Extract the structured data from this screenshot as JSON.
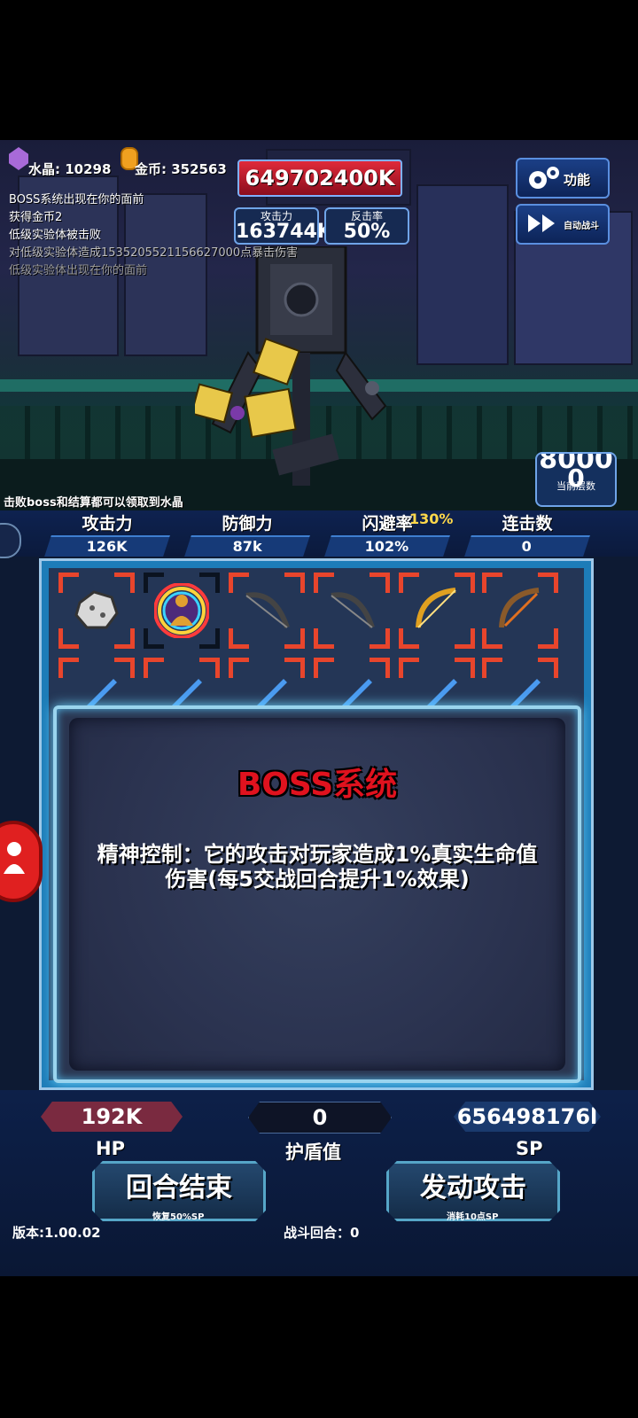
{
  "resources": {
    "crystal_label": "水晶:",
    "crystal_value": "10298",
    "gold_label": "金币:",
    "gold_value": "352563"
  },
  "boss": {
    "hp": "649702400K",
    "attack_label": "攻击力",
    "attack_value": "163744K",
    "counter_label": "反击率",
    "counter_value": "50%"
  },
  "log": [
    "BOSS系统出现在你的面前",
    "获得金币2",
    "低级实验体被击败",
    "对低级实验体造成1535205521156627000点暴击伤害",
    "低级实验体出现在你的面前"
  ],
  "menu": {
    "function_label": "功能",
    "auto_battle_label": "自动战斗"
  },
  "floor": {
    "top_value": "8000",
    "current_value": "0",
    "label": "当前层数"
  },
  "hint": "击败boss和结算都可以领取到水晶",
  "player_stats": {
    "attack_label": "攻击力",
    "attack_value": "126K",
    "defense_label": "防御力",
    "defense_value": "87k",
    "dodge_label": "闪避率",
    "dodge_value": "102%",
    "dodge_bonus": "130%",
    "combo_label": "连击数",
    "combo_value": "0"
  },
  "inventory_icons": [
    "rock-icon",
    "buddha-icon",
    "dark-bow-icon",
    "dark-bow-icon",
    "golden-bow-icon",
    "wooden-bow-icon",
    "blue-sword-icon",
    "blue-sword-icon",
    "blue-sword-icon",
    "blue-sword-icon",
    "blue-sword-icon",
    "blue-sword-icon"
  ],
  "dialog": {
    "title": "BOSS系统",
    "text": "精神控制：它的攻击对玩家造成1%真实生命值伤害(每5交战回合提升1%效果)"
  },
  "bottom": {
    "hp_value": "192K",
    "hp_label": "HP",
    "shield_value": "0",
    "shield_label": "护盾值",
    "sp_value": "656498176l",
    "sp_label": "SP",
    "end_turn_label": "回合结束",
    "end_turn_sub": "恢复50%SP",
    "attack_label": "发动攻击",
    "attack_sub": "消耗10点SP",
    "version": "版本:1.00.02",
    "round": "战斗回合：0"
  },
  "colors": {
    "hp_red": "#e02a3a",
    "accent_blue": "#1d7cb8",
    "title_red": "#e0121e",
    "bonus_yellow": "#ffd84a"
  }
}
